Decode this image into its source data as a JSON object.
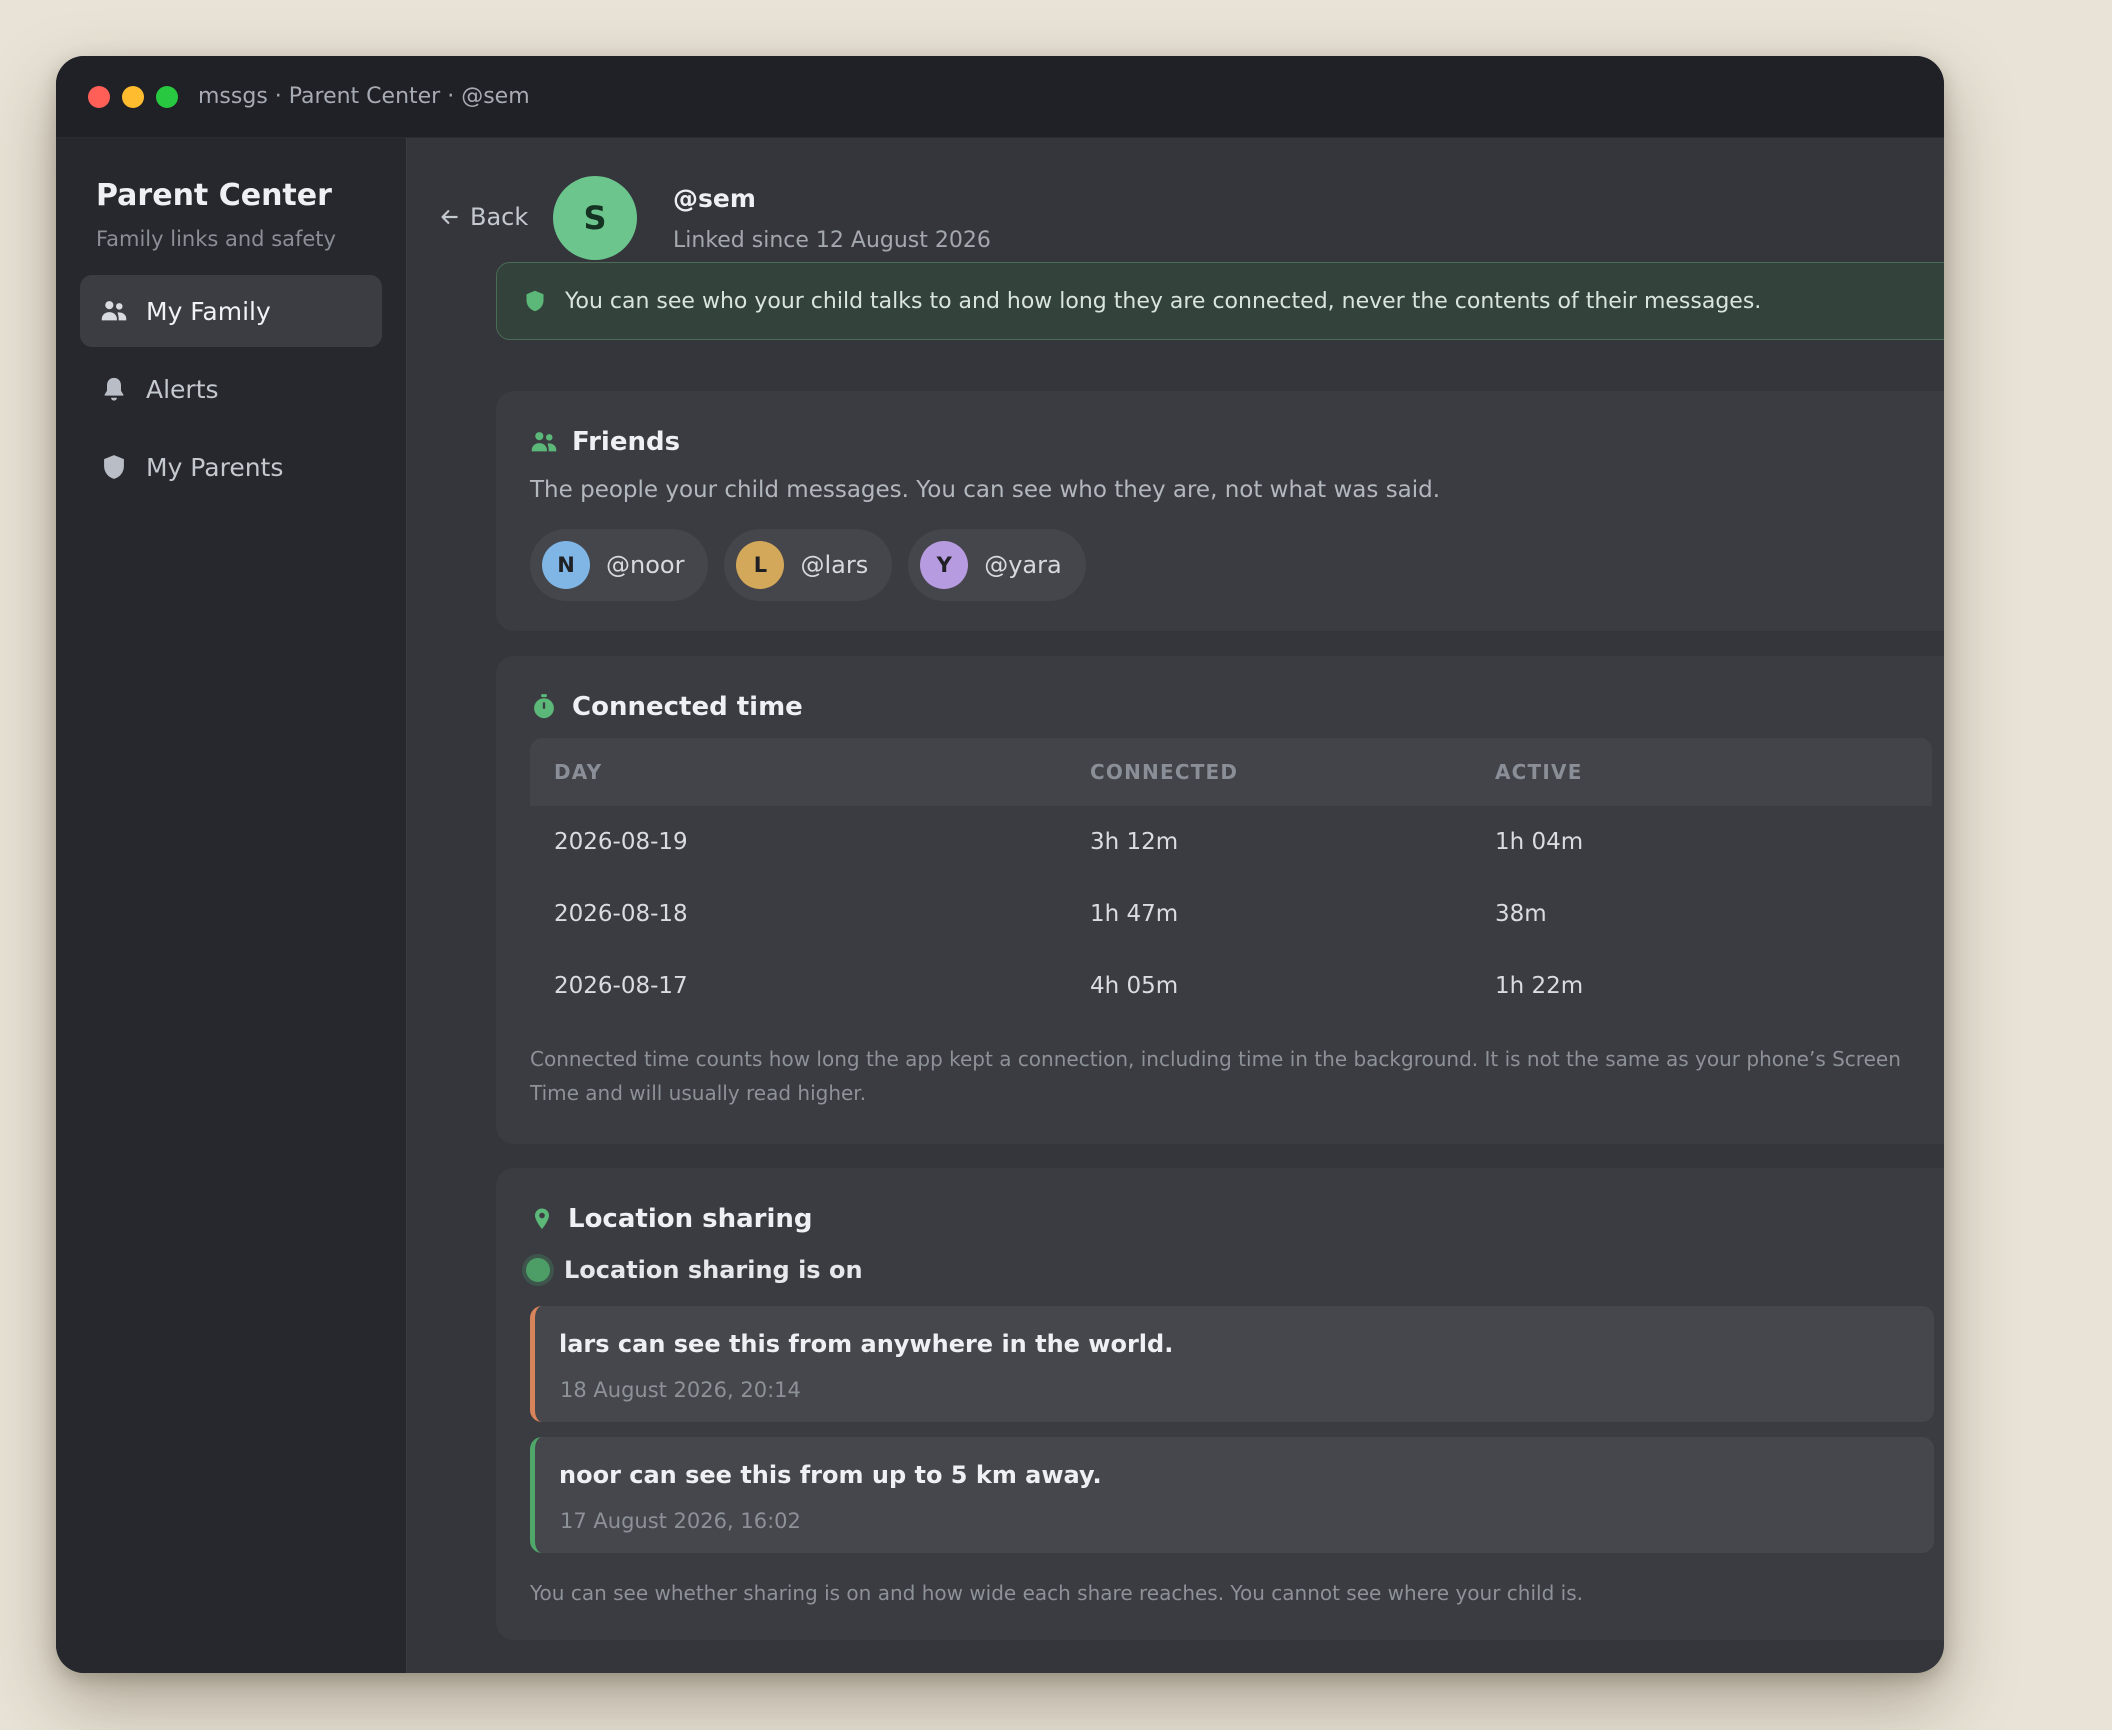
{
  "window": {
    "title": "mssgs · Parent Center · @sem"
  },
  "sidebar": {
    "title": "Parent Center",
    "subtitle": "Family links and safety",
    "items": [
      {
        "label": "My Family",
        "icon": "users-icon",
        "active": true
      },
      {
        "label": "Alerts",
        "icon": "bell-icon",
        "active": false
      },
      {
        "label": "My Parents",
        "icon": "shield-icon",
        "active": false
      }
    ]
  },
  "header": {
    "back_label": "Back",
    "avatar_initial": "S",
    "avatar_color": "#6cc58d",
    "username": "@sem",
    "linked_since": "Linked since 12 August 2026"
  },
  "notice": {
    "icon": "shield-icon",
    "text": "You can see who your child talks to and how long they are connected, never the contents of their messages."
  },
  "friends": {
    "title": "Friends",
    "description": "The people your child messages. You can see who they are, not what was said.",
    "list": [
      {
        "initial": "N",
        "handle": "@noor",
        "color": "#7fb6e6"
      },
      {
        "initial": "L",
        "handle": "@lars",
        "color": "#d4a85a"
      },
      {
        "initial": "Y",
        "handle": "@yara",
        "color": "#b79be0"
      }
    ]
  },
  "connected_time": {
    "title": "Connected time",
    "columns": [
      "DAY",
      "CONNECTED",
      "ACTIVE"
    ],
    "rows": [
      {
        "day": "2026-08-19",
        "connected": "3h 12m",
        "active": "1h 04m"
      },
      {
        "day": "2026-08-18",
        "connected": "1h 47m",
        "active": "38m"
      },
      {
        "day": "2026-08-17",
        "connected": "4h 05m",
        "active": "1h 22m"
      }
    ],
    "footnote": "Connected time counts how long the app kept a connection, including time in the background. It is not the same as your phone’s Screen Time and will usually read higher."
  },
  "location": {
    "title": "Location sharing",
    "status": "Location sharing is on",
    "shares": [
      {
        "text": "lars can see this from anywhere in the world.",
        "time": "18 August 2026, 20:14",
        "accent": "#d8845a"
      },
      {
        "text": "noor can see this from up to 5 km away.",
        "time": "17 August 2026, 16:02",
        "accent": "#4fa76a"
      }
    ],
    "footnote": "You can see whether sharing is on and how wide each share reaches. You cannot see where your child is."
  }
}
